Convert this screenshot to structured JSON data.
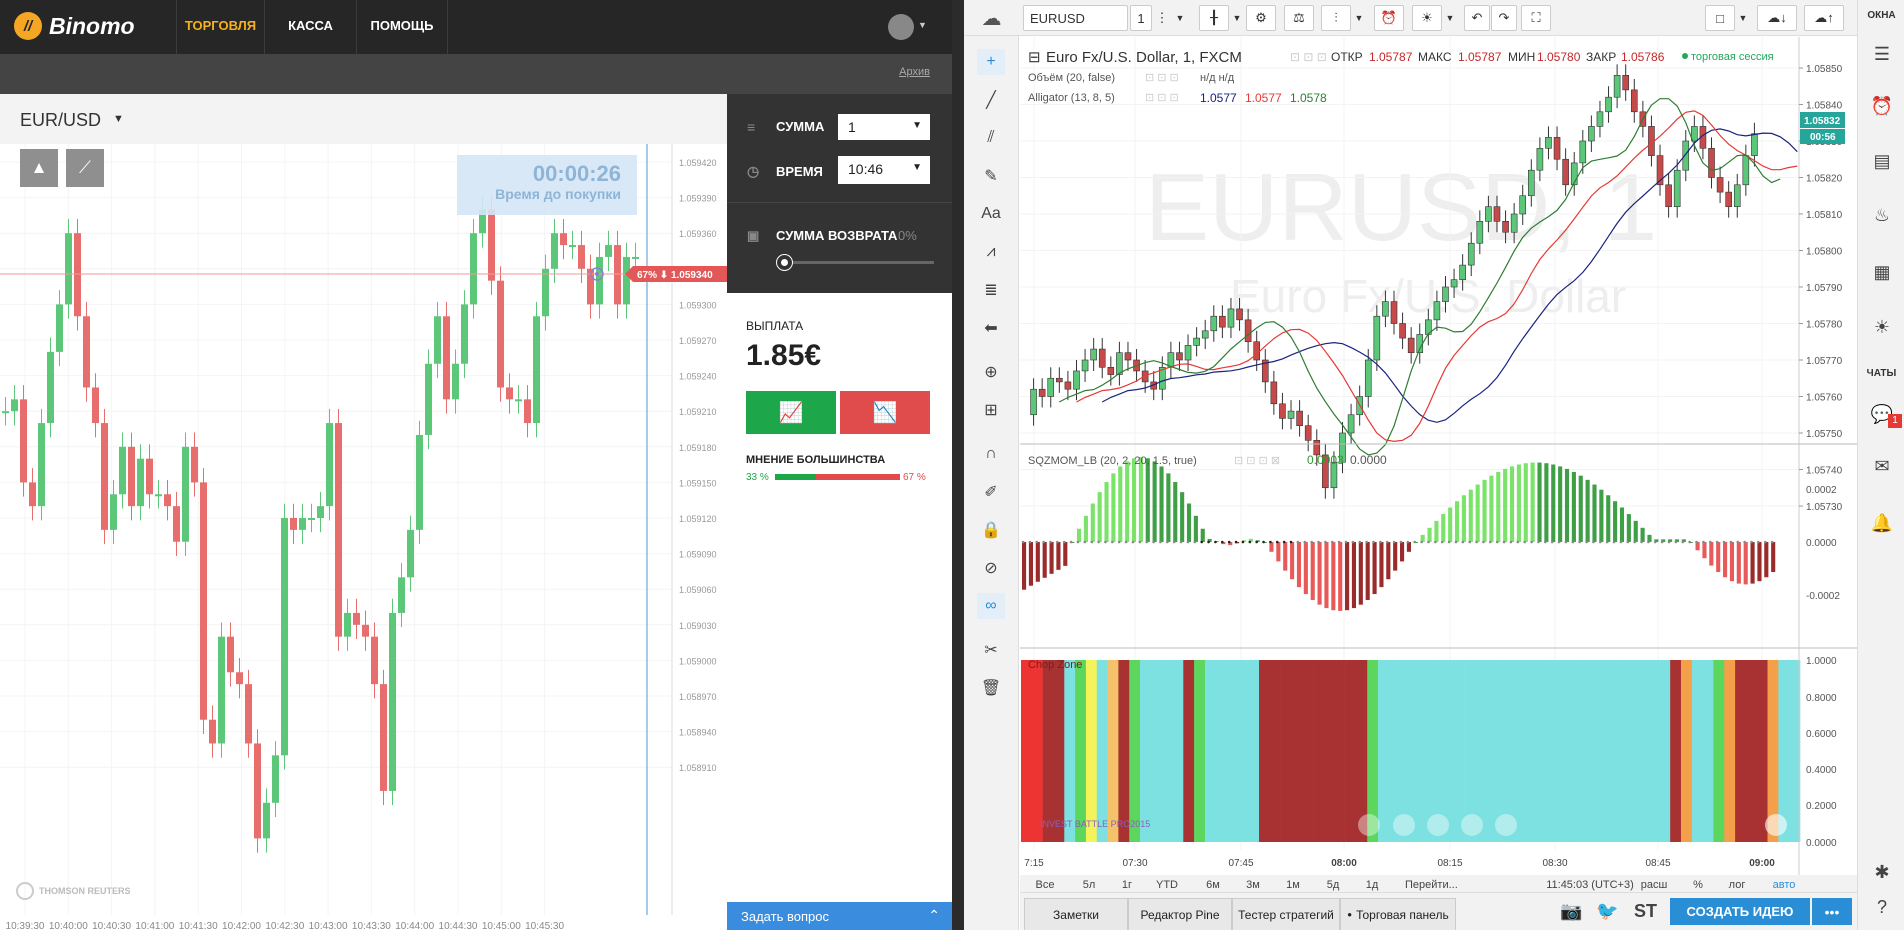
{
  "binomo": {
    "logo": "Binomo",
    "nav": [
      "ТОРГОВЛЯ",
      "КАССА",
      "ПОМОЩЬ"
    ],
    "archive_link": "Архив",
    "pair": "EUR/USD",
    "timer": "00:00:26",
    "timer_label": "Время до покупки",
    "price_marker": "67% ⬇ 1.059340",
    "price_ticks": [
      "1.059420",
      "1.059390",
      "1.059360",
      "1.059330",
      "1.059300",
      "1.059270",
      "1.059240",
      "1.059210",
      "1.059180",
      "1.059150",
      "1.059120",
      "1.059090",
      "1.059060",
      "1.059030",
      "1.059000",
      "1.058970",
      "1.058940",
      "1.058910"
    ],
    "time_ticks": [
      "10:39:30",
      "10:40:00",
      "10:40:30",
      "10:41:00",
      "10:41:30",
      "10:42:00",
      "10:42:30",
      "10:43:00",
      "10:43:30",
      "10:44:00",
      "10:44:30",
      "10:45:00",
      "10:45:30"
    ],
    "sum_label": "СУММА",
    "sum_value": "1",
    "time_label": "ВРЕМЯ",
    "time_value": "10:46",
    "refund_label": "СУММА ВОЗВРАТА",
    "refund_value": "0%",
    "payout_label": "ВЫПЛАТА",
    "payout_value": "1.85€",
    "majority_label": "МНЕНИЕ БОЛЬШИНСТВА",
    "majority_up": "33 %",
    "majority_down": "67 %",
    "majority_up_fraction": 0.33,
    "reuters": "THOMSON REUTERS",
    "ask_question": "Задать вопрос",
    "colors": {
      "up": "#5cc679",
      "down": "#e86e6e",
      "buy": "#1ea64a",
      "sell": "#e04b4b"
    }
  },
  "tradingview": {
    "symbol": "EURUSD",
    "interval": "1",
    "title": "Euro Fx/U.S. Dollar, 1, FXCM",
    "ohlc": {
      "o_label": "ОТКР",
      "o": "1.05787",
      "h_label": "МАКС",
      "h": "1.05787",
      "l_label": "МИН",
      "l": "1.05780",
      "c_label": "ЗАКР",
      "c": "1.05786"
    },
    "session": "торговая сессия",
    "volume_study": "Объём (20, false)",
    "volume_values": "н/д н/д",
    "alligator_study": "Alligator (13, 8, 5)",
    "alligator_values": [
      "1.0577",
      "1.0577",
      "1.0578"
    ],
    "watermark_big": "EURUSD, 1",
    "watermark_small": "Euro Fx/U.S. Dollar",
    "price_ticks": [
      "1.05850",
      "1.05840",
      "1.05830",
      "1.05820",
      "1.05810",
      "1.05800",
      "1.05790",
      "1.05780",
      "1.05770",
      "1.05760",
      "1.05750",
      "1.05740",
      "1.05730"
    ],
    "last_price": "1.05832",
    "countdown": "00:56",
    "sqz_study": "SQZMOM_LB (20, 2, 20, 1.5, true)",
    "sqz_values": [
      "0.0003",
      "0.0000"
    ],
    "sqz_ticks": [
      "0.0002",
      "0.0000",
      "-0.0002"
    ],
    "chop_study": "Chop Zone",
    "chop_ticks": [
      "1.0000",
      "0.8000",
      "0.6000",
      "0.4000",
      "0.2000",
      "0.0000"
    ],
    "watermark_logo": "INVEST BATTLE PRO2015",
    "time_ticks": [
      "7:15",
      "07:30",
      "07:45",
      "08:00",
      "08:15",
      "08:30",
      "08:45",
      "09:00"
    ],
    "ranges": [
      "Все",
      "5л",
      "1г",
      "YTD",
      "6м",
      "3м",
      "1м",
      "5д",
      "1д"
    ],
    "goto": "Перейти...",
    "clock": "11:45:03 (UTC+3)",
    "scale_opts": [
      "расш",
      "%",
      "лог",
      "авто"
    ],
    "bottom_tabs": [
      "Заметки",
      "Редактор Pine",
      "Тестер стратегий",
      "Торговая панель"
    ],
    "create_idea": "СОЗДАТЬ ИДЕЮ",
    "right_labels": [
      "ОКНА",
      "ЧАТЫ"
    ],
    "chat_badge": "1",
    "colors": {
      "up": "#5cc679",
      "down": "#c74a4a",
      "jaw": "#1a237e",
      "teeth": "#e53935",
      "lips": "#2e7d32",
      "accent": "#2a8ed6"
    }
  }
}
